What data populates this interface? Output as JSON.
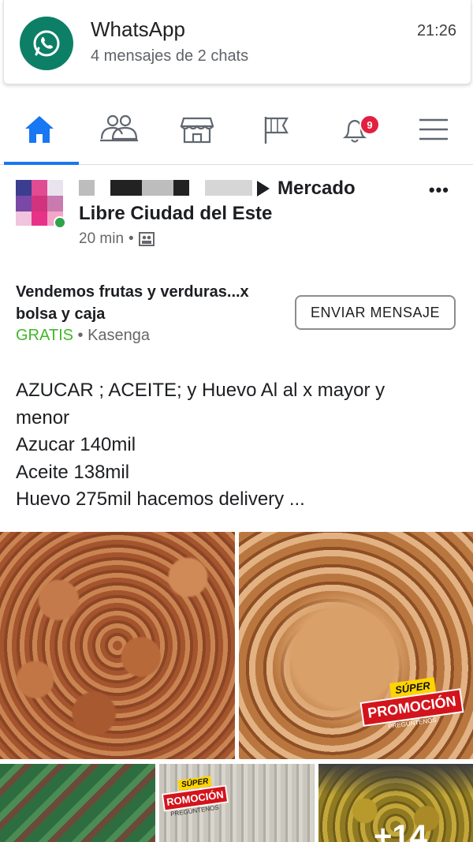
{
  "notification": {
    "app_name": "WhatsApp",
    "summary": "4 mensajes de 2 chats",
    "time": "21:26",
    "icon": "whatsapp-icon",
    "accent_color": "#0d7f67"
  },
  "nav": {
    "items": [
      {
        "name": "home",
        "icon": "home-icon",
        "active": true
      },
      {
        "name": "friends",
        "icon": "friends-icon"
      },
      {
        "name": "marketplace",
        "icon": "marketplace-icon"
      },
      {
        "name": "pages",
        "icon": "flag-icon"
      },
      {
        "name": "notifications",
        "icon": "bell-icon",
        "badge": "9"
      },
      {
        "name": "menu",
        "icon": "menu-icon"
      }
    ],
    "notification_badge": "9",
    "accent_color": "#1877f2"
  },
  "post": {
    "group_name_line1": "Mercado",
    "group_name_line2": "Libre Ciudad del Este",
    "time": "20 min",
    "audience_separator": "•",
    "listing": {
      "title": "Vendemos frutas y verduras...x bolsa y caja",
      "price": "GRATIS",
      "separator": " • ",
      "location": "Kasenga",
      "send_button": "ENVIAR MENSAJE"
    },
    "text_lines": [
      "AZUCAR ; ACEITE; y Huevo Al al x mayor y",
      "menor",
      "Azucar 140mil",
      "Aceite 138mil",
      "Huevo 275mil hacemos delivery ..."
    ],
    "promo": {
      "sup": "SÚPER",
      "main": "PROMOCIÓN",
      "sub": "PREGÚNTENOS",
      "main_cropped": "ROMOCIÓN"
    },
    "more_photos_label": "+14"
  }
}
